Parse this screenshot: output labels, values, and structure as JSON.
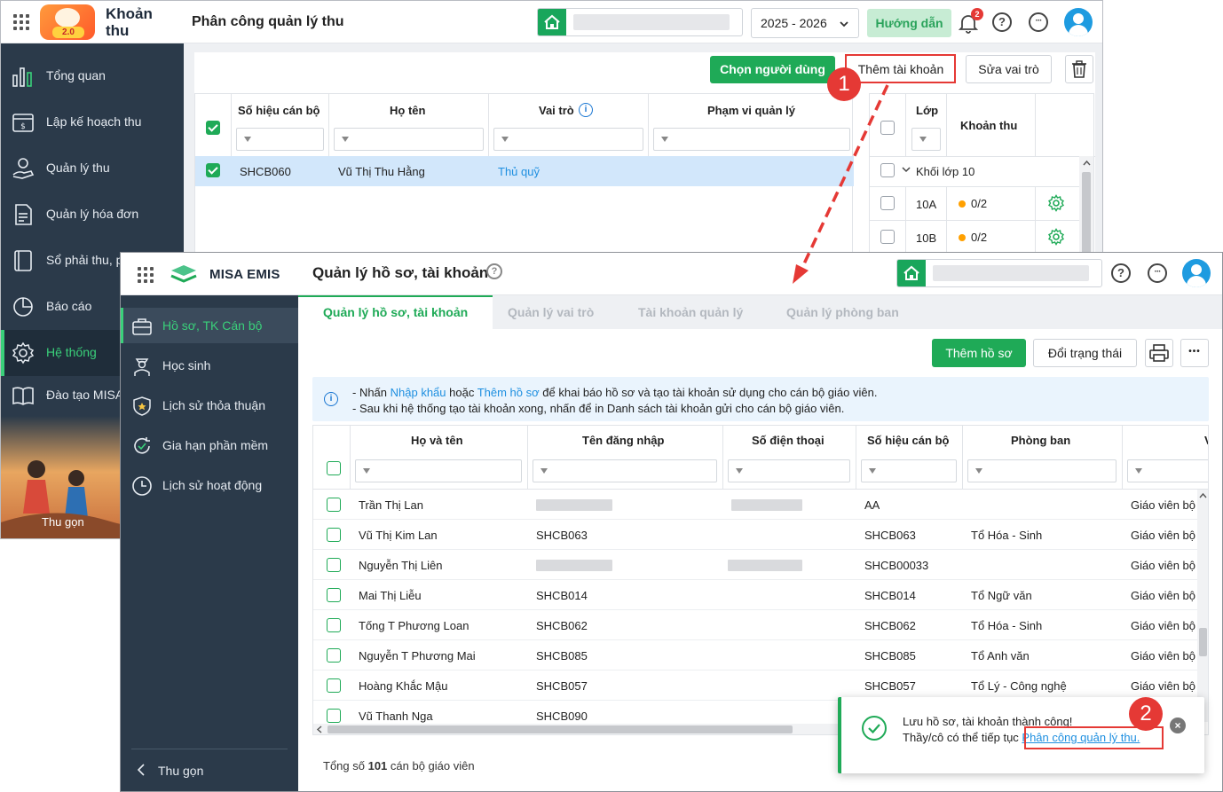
{
  "back_window": {
    "app_name": "Khoản thu",
    "logo_version": "2.0",
    "page_title": "Phân công quản lý thu",
    "school_year": "2025 - 2026",
    "guide_label": "Hướng dẫn",
    "notification_count": "2",
    "help_glyph": "?",
    "more_glyph": "···",
    "sidebar": {
      "items": [
        {
          "label": "Tổng quan",
          "icon": "chart-bars-icon"
        },
        {
          "label": "Lập kế hoạch thu",
          "icon": "calendar-money-icon"
        },
        {
          "label": "Quản lý thu",
          "icon": "hand-coin-icon"
        },
        {
          "label": "Quản lý hóa đơn",
          "icon": "invoice-icon"
        },
        {
          "label": "Sổ phải thu, p",
          "icon": "ledger-book-icon"
        },
        {
          "label": "Báo cáo",
          "icon": "pie-chart-icon"
        },
        {
          "label": "Hệ thống",
          "icon": "gear-icon"
        },
        {
          "label": "Đào tạo MISA",
          "icon": "open-book-icon"
        }
      ],
      "collapse_label": "Thu gọn"
    },
    "buttons": {
      "select_user": "Chọn người dùng",
      "add_account": "Thêm tài khoản",
      "edit_role": "Sửa vai trò"
    },
    "table": {
      "columns": [
        "Số hiệu cán bộ",
        "Họ tên",
        "Vai trò",
        "Phạm vi quản lý"
      ],
      "rows": [
        {
          "code": "SHCB060",
          "name": "Vũ Thị Thu Hằng",
          "role": "Thủ quỹ",
          "scope": ""
        }
      ]
    },
    "fee_table": {
      "columns": [
        "Lớp",
        "Khoản thu"
      ],
      "group": "Khối lớp 10",
      "rows": [
        {
          "class": "10A",
          "fee": "0/2"
        },
        {
          "class": "10B",
          "fee": "0/2"
        }
      ]
    },
    "step_label": "1"
  },
  "front_window": {
    "brand": "MISA EMIS",
    "page_title": "Quản lý hồ sơ, tài khoản",
    "help_glyph": "?",
    "more_glyph": "···",
    "sidebar": {
      "items": [
        {
          "label": "Hồ sơ, TK Cán bộ",
          "icon": "briefcase-icon"
        },
        {
          "label": "Học sinh",
          "icon": "student-icon"
        },
        {
          "label": "Lịch sử thỏa thuận",
          "icon": "shield-star-icon"
        },
        {
          "label": "Gia hạn phần mềm",
          "icon": "renew-icon"
        },
        {
          "label": "Lịch sử hoạt động",
          "icon": "clock-icon"
        }
      ],
      "collapse_label": "Thu gọn"
    },
    "tabs": [
      {
        "label": "Quản lý hồ sơ, tài khoản"
      },
      {
        "label": "Quản lý vai trò"
      },
      {
        "label": "Tài khoản quản lý"
      },
      {
        "label": "Quản lý phòng ban"
      }
    ],
    "buttons": {
      "add_profile": "Thêm hồ sơ",
      "change_status": "Đổi trạng thái",
      "more": "•••"
    },
    "notice": {
      "line1_prefix": "- Nhấn ",
      "line1_link1": "Nhập khẩu",
      "line1_mid": " hoặc ",
      "line1_link2": "Thêm hồ sơ",
      "line1_suffix": " để khai báo hồ sơ và tạo tài khoản sử dụng cho cán bộ giáo viên.",
      "line2": "- Sau khi hệ thống tạo tài khoản xong, nhấn để in Danh sách tài khoản gửi cho cán bộ giáo viên."
    },
    "table": {
      "columns": [
        "Họ và tên",
        "Tên đăng nhập",
        "Số điện thoại",
        "Số hiệu cán bộ",
        "Phòng ban",
        "V"
      ],
      "rows": [
        {
          "name": "Trần Thị Lan",
          "username": "",
          "phone": "",
          "code": "AA",
          "dept": "",
          "role": "Giáo viên bộ môn"
        },
        {
          "name": "Vũ Thị Kim Lan",
          "username": "SHCB063",
          "phone": "",
          "code": "SHCB063",
          "dept": "Tổ Hóa - Sinh",
          "role": "Giáo viên bộ môn"
        },
        {
          "name": "Nguyễn Thị Liên",
          "username": "",
          "phone": "",
          "code": "SHCB00033",
          "dept": "",
          "role": "Giáo viên bộ môn"
        },
        {
          "name": "Mai Thị Liễu",
          "username": "SHCB014",
          "phone": "",
          "code": "SHCB014",
          "dept": "Tổ Ngữ văn",
          "role": "Giáo viên bộ môn"
        },
        {
          "name": "Tống T Phương Loan",
          "username": "SHCB062",
          "phone": "",
          "code": "SHCB062",
          "dept": "Tổ Hóa - Sinh",
          "role": "Giáo viên bộ môn"
        },
        {
          "name": "Nguyễn T Phương Mai",
          "username": "SHCB085",
          "phone": "",
          "code": "SHCB085",
          "dept": "Tổ Anh văn",
          "role": "Giáo viên bộ môn"
        },
        {
          "name": "Hoàng Khắc Mậu",
          "username": "SHCB057",
          "phone": "",
          "code": "SHCB057",
          "dept": "Tổ Lý - Công nghệ",
          "role": "Giáo viên bộ môn"
        },
        {
          "name": "Vũ Thanh Nga",
          "username": "SHCB090",
          "phone": "",
          "code": "",
          "dept": "",
          "role": ""
        }
      ]
    },
    "footer": {
      "prefix": "Tổng số ",
      "count": "101",
      "suffix": " cán bộ giáo viên"
    }
  },
  "toast": {
    "line1": "Lưu hồ sơ, tài khoản thành công!",
    "line2_prefix": "Thầy/cô có thể tiếp tục ",
    "line2_link": "Phân công quản lý thu.",
    "close_glyph": "×",
    "step_label": "2"
  },
  "colors": {
    "accent_green": "#1faa57",
    "sidebar_bg": "#2b3a4a",
    "link_blue": "#1e8fe0",
    "highlight_red": "#e53935"
  }
}
